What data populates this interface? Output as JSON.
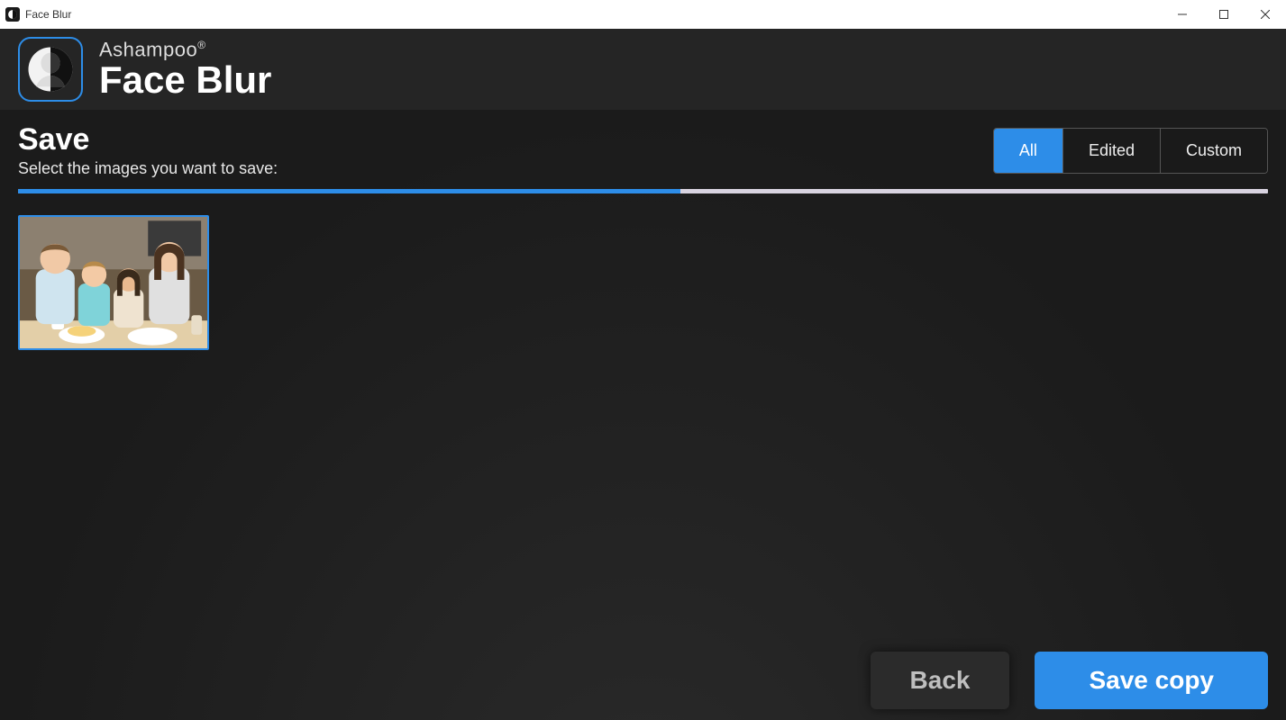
{
  "window": {
    "title": "Face Blur"
  },
  "brand": {
    "company": "Ashampoo",
    "registered": "®",
    "product": "Face Blur"
  },
  "page": {
    "heading": "Save",
    "subheading": "Select the images you want to save:",
    "progress_percent": 53
  },
  "filter_tabs": {
    "all": "All",
    "edited": "Edited",
    "custom": "Custom",
    "active": "all"
  },
  "thumbnails": [
    {
      "alt": "Family photo with four people at a table",
      "selected": true
    }
  ],
  "footer": {
    "back": "Back",
    "save_copy": "Save copy"
  },
  "colors": {
    "accent": "#2d8de8"
  }
}
